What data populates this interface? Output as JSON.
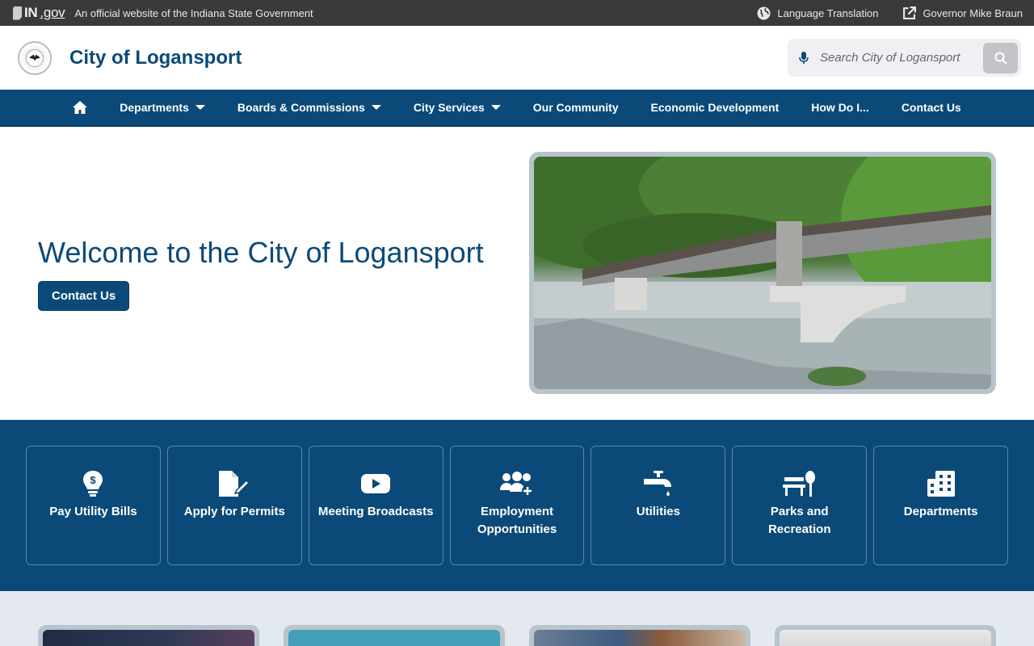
{
  "statebar": {
    "logo_in": "IN",
    "logo_gov": ".gov",
    "official_text": "An official website of the Indiana State Government",
    "language_label": "Language Translation",
    "governor_label": "Governor Mike Braun"
  },
  "header": {
    "site_title": "City of Logansport",
    "search_placeholder": "Search City of Logansport"
  },
  "nav": {
    "items": [
      {
        "label": "Departments",
        "dropdown": true
      },
      {
        "label": "Boards & Commissions",
        "dropdown": true
      },
      {
        "label": "City Services",
        "dropdown": true
      },
      {
        "label": "Our Community",
        "dropdown": false
      },
      {
        "label": "Economic Development",
        "dropdown": false
      },
      {
        "label": "How Do I...",
        "dropdown": false
      },
      {
        "label": "Contact Us",
        "dropdown": false
      }
    ]
  },
  "hero": {
    "title": "Welcome to the City of Logansport",
    "button_label": "Contact Us"
  },
  "quick_links": [
    {
      "label": "Pay Utility Bills",
      "icon": "lightbulb-dollar-icon"
    },
    {
      "label": "Apply for Permits",
      "icon": "file-signature-icon"
    },
    {
      "label": "Meeting Broadcasts",
      "icon": "youtube-icon"
    },
    {
      "label": "Employment Opportunities",
      "icon": "users-plus-icon"
    },
    {
      "label": "Utilities",
      "icon": "faucet-icon"
    },
    {
      "label": "Parks and Recreation",
      "icon": "park-bench-tree-icon"
    },
    {
      "label": "Departments",
      "icon": "building-icon"
    }
  ],
  "colors": {
    "brand": "#0b4a78",
    "statebar": "#3a3a3a",
    "page_bg_light": "#e4e9f0"
  }
}
